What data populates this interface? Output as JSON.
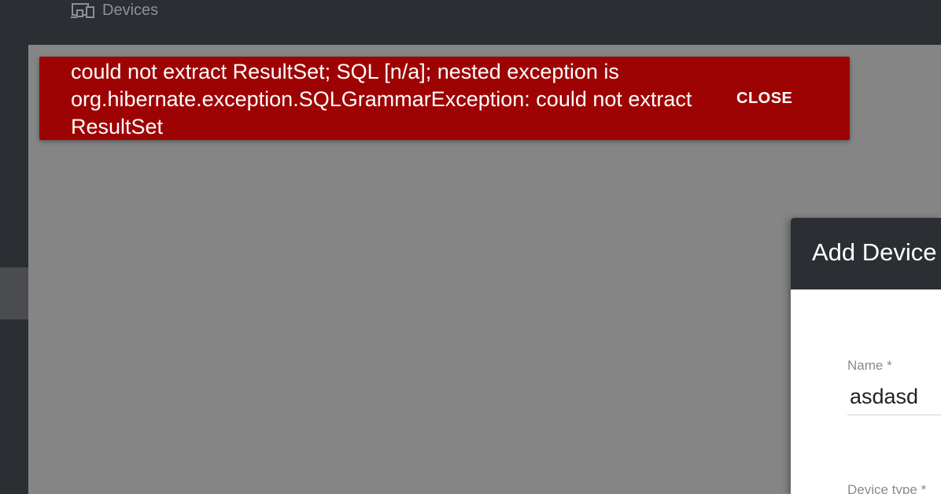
{
  "topbar": {
    "breadcrumb": {
      "icon": "devices-icon",
      "label": "Devices"
    }
  },
  "snackbar": {
    "message": "could not extract ResultSet; SQL [n/a]; nested exception is org.hibernate.exception.SQLGrammarException: could not extract ResultSet",
    "close_label": "CLOSE",
    "color": "#9e0303"
  },
  "dialog": {
    "title": "Add Device",
    "fields": {
      "name": {
        "label": "Name",
        "required_mark": "*",
        "value": "asdasd"
      },
      "device_type": {
        "label": "Device type",
        "required_mark": "*"
      }
    }
  },
  "colors": {
    "header_bg": "#2b2e33",
    "overlay": "#858585",
    "error": "#9e0303"
  }
}
